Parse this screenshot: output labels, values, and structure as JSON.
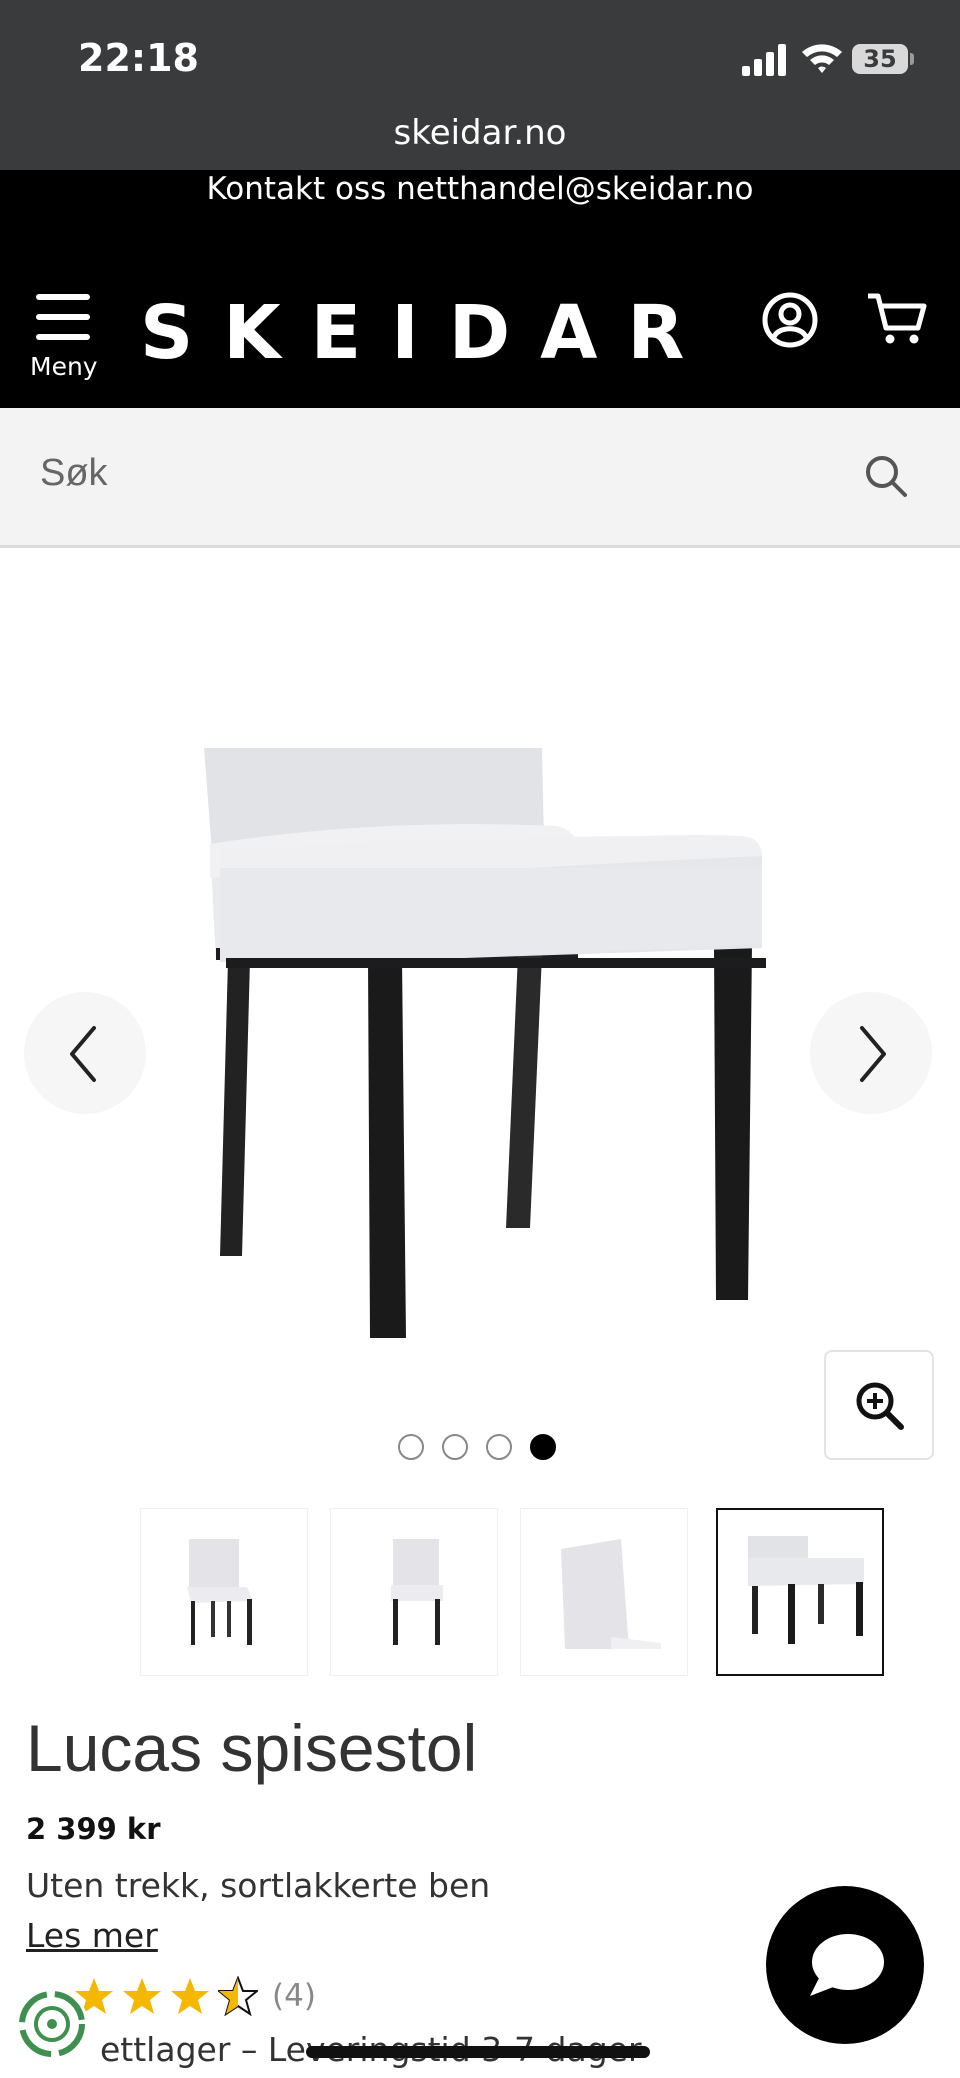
{
  "status_bar": {
    "time": "22:18",
    "battery": "35"
  },
  "browser": {
    "url": "skeidar.no"
  },
  "contact_bar": {
    "text": "Kontakt oss netthandel@skeidar.no"
  },
  "header": {
    "logo": "SKEIDAR",
    "menu_label": "Meny"
  },
  "search": {
    "placeholder": "Søk"
  },
  "gallery": {
    "slide_count": 4,
    "active_slide": 4,
    "thumbnail_count": 4
  },
  "product": {
    "title": "Lucas spisestol",
    "price": "2 399 kr",
    "variant": "Uten trekk, sortlakkerte ben",
    "read_more": "Les mer",
    "rating": 3.5,
    "review_count": "(4)",
    "stock": "ettlager – Leveringstid 3-7 dager"
  },
  "colors": {
    "header_bg": "#000000",
    "status_bg": "#3a3b3d",
    "star": "#f5b800",
    "search_bg": "#f3f3f3"
  }
}
